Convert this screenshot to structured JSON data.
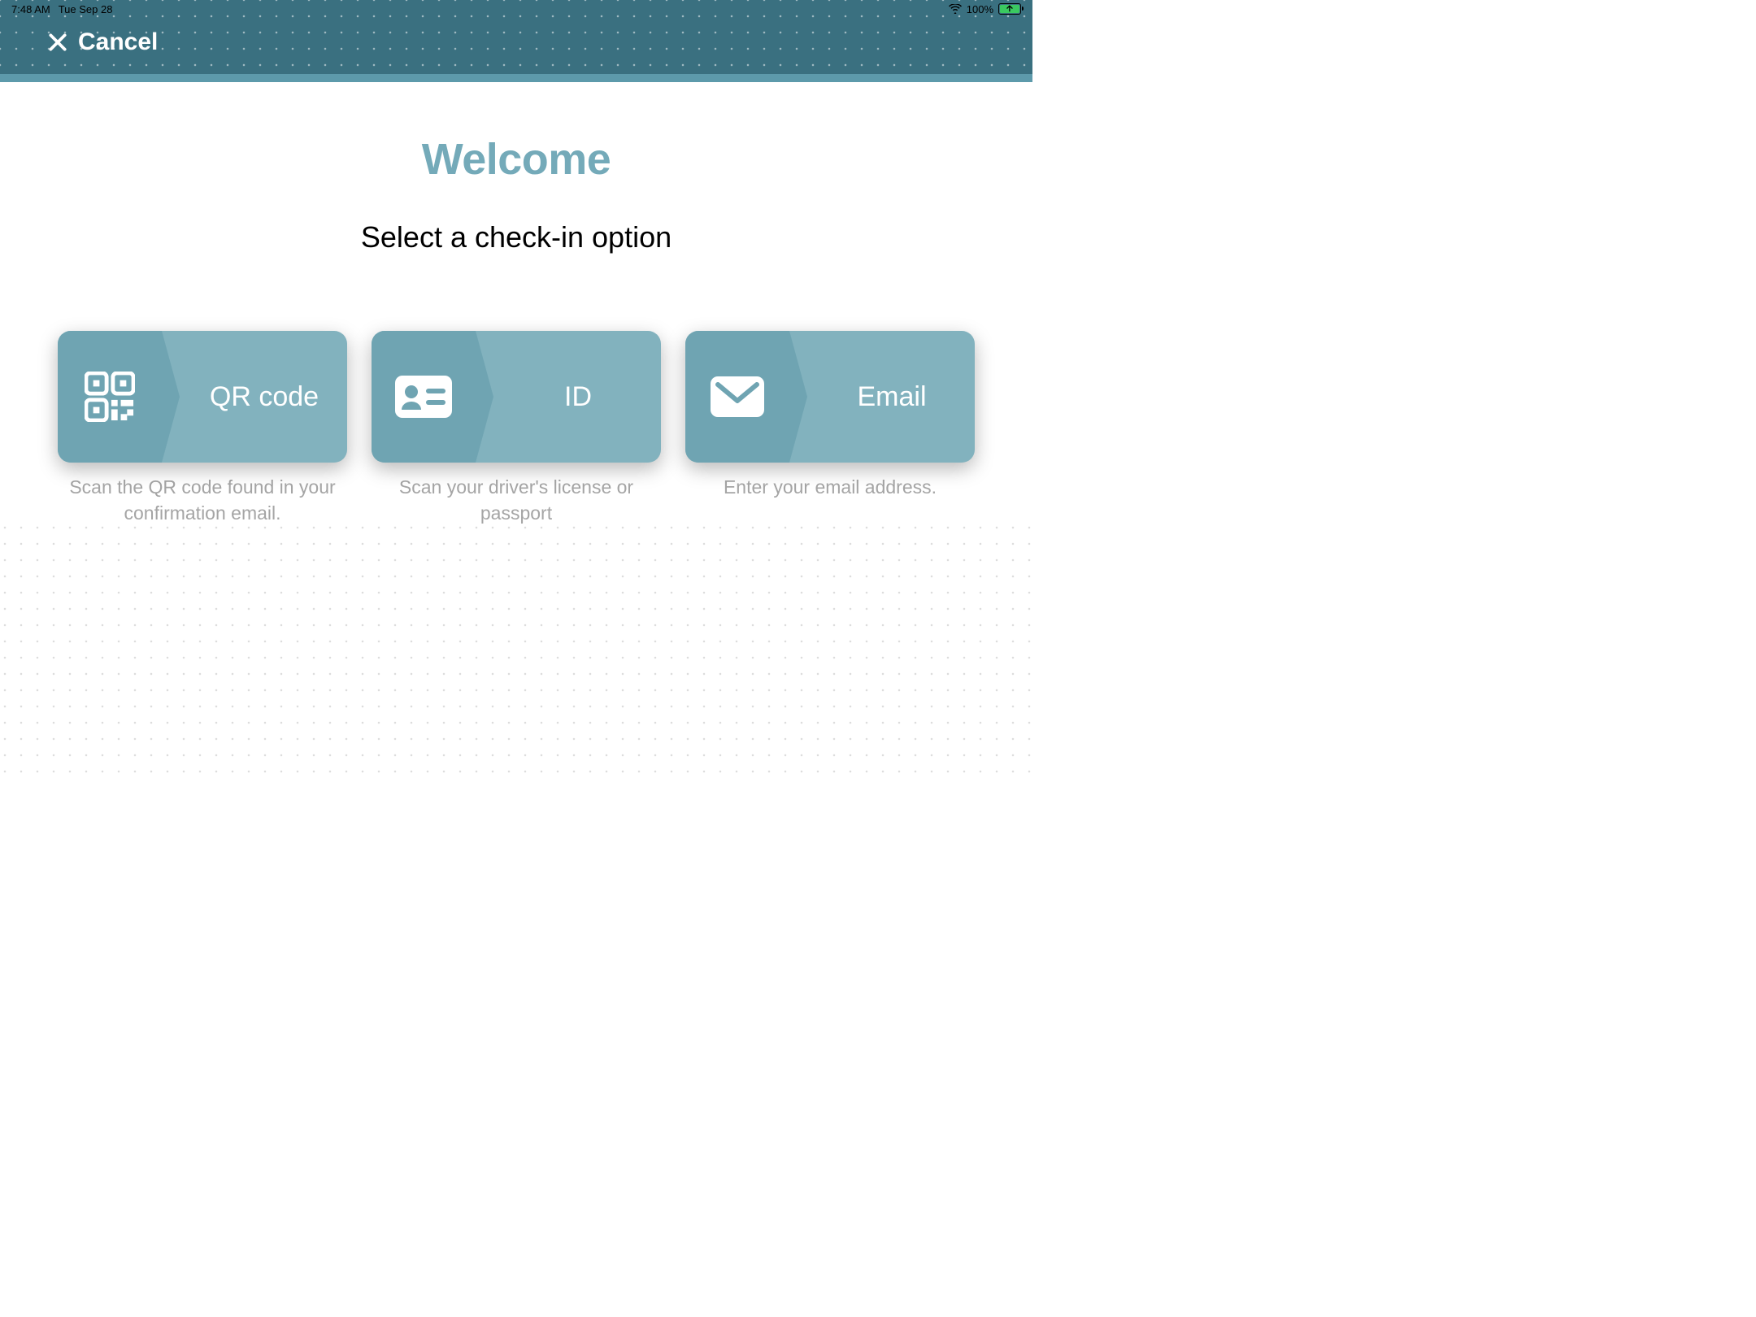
{
  "status_bar": {
    "time": "7:48 AM",
    "date": "Tue Sep 28",
    "battery_percent": "100%"
  },
  "header": {
    "cancel_label": "Cancel"
  },
  "main": {
    "title": "Welcome",
    "subtitle": "Select a check-in option"
  },
  "options": [
    {
      "icon": "qr-code-icon",
      "label": "QR code",
      "description": "Scan the QR code found in your confirmation email."
    },
    {
      "icon": "id-card-icon",
      "label": "ID",
      "description": "Scan your driver's license or passport"
    },
    {
      "icon": "email-icon",
      "label": "Email",
      "description": "Enter your email address."
    }
  ]
}
